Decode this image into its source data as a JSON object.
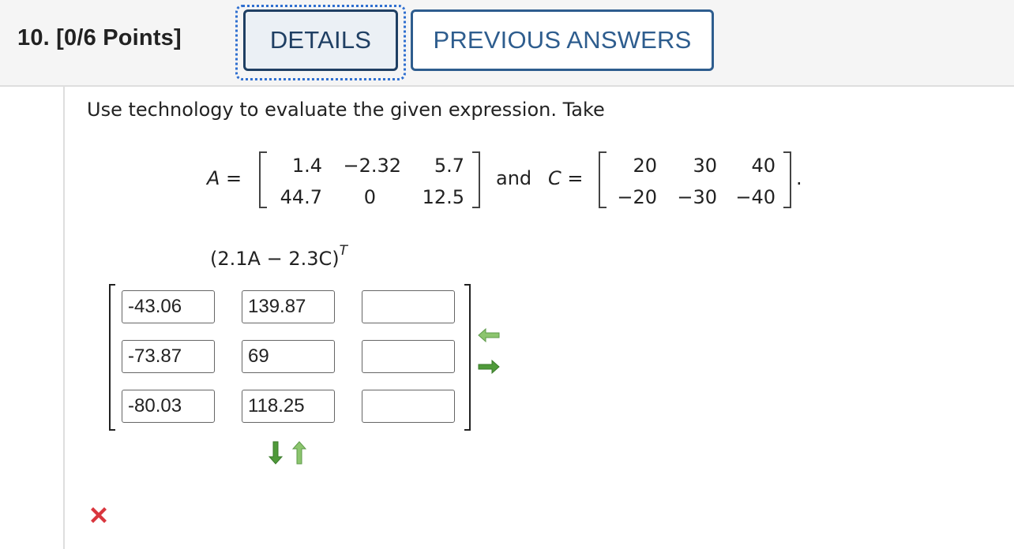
{
  "header": {
    "question_title": "10.  [0/6 Points]",
    "details_label": "DETAILS",
    "previous_answers_label": "PREVIOUS ANSWERS"
  },
  "instructions": "Use technology to evaluate the given expression. Take",
  "matrix_a": {
    "label": "A =",
    "rows": [
      [
        "1.4",
        "−2.32",
        "5.7"
      ],
      [
        "44.7",
        "0",
        "12.5"
      ]
    ]
  },
  "connector": "and",
  "matrix_c": {
    "label": "C =",
    "rows": [
      [
        "20",
        "30",
        "40"
      ],
      [
        "−20",
        "−30",
        "−40"
      ]
    ],
    "end_punct": "."
  },
  "expression": {
    "text": "(2.1A − 2.3C)",
    "superscript": "T"
  },
  "answer_grid": {
    "rows": [
      [
        "-43.06",
        "139.87",
        ""
      ],
      [
        "-73.87",
        "69",
        ""
      ],
      [
        "-80.03",
        "118.25",
        ""
      ]
    ]
  },
  "controls": {
    "remove_column_icon": "arrow-left-icon",
    "add_column_icon": "arrow-right-icon",
    "add_row_icon": "arrow-down-icon",
    "remove_row_icon": "arrow-up-icon"
  },
  "status": {
    "icon": "incorrect-x-icon",
    "color": "#d9363e"
  }
}
